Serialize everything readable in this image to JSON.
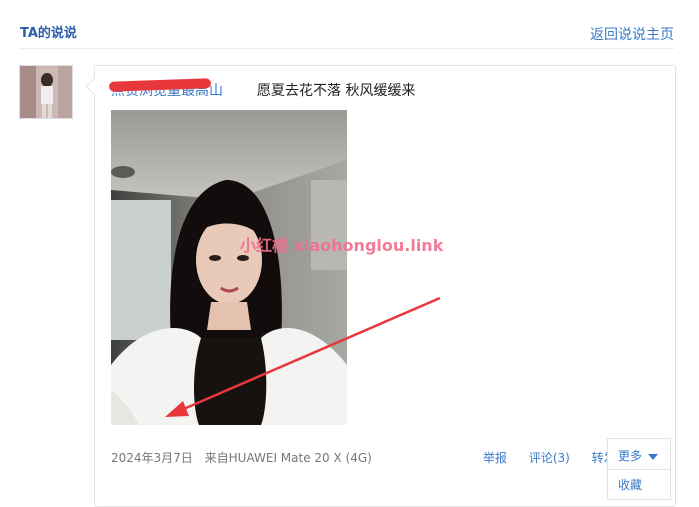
{
  "header": {
    "title": "TA的说说",
    "back_link": "返回说说主页"
  },
  "post": {
    "author": "点赞浏览量最高山",
    "text": "愿夏去花不落 秋风缓缓来",
    "watermark": "小红楼  xiaohonglou.link",
    "date": "2024年3月7日",
    "source": "来自HUAWEI Mate 20 X (4G)",
    "actions": {
      "report": "举报",
      "comment": "评论(3)",
      "forward": "转发",
      "more": "更多",
      "menu_first": "收藏"
    }
  },
  "colors": {
    "link": "#3b7ac9",
    "title": "#2b5dab",
    "redaction": "#e8383b",
    "annotation_arrow": "#e8383b"
  },
  "icons": [
    "caret-down-icon"
  ]
}
